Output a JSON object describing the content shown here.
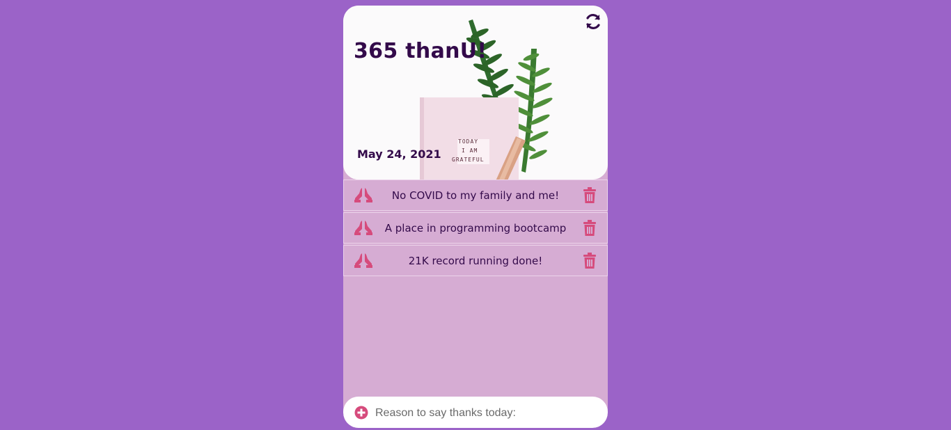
{
  "app": {
    "title": "365 thanU!",
    "date": "May 24, 2021"
  },
  "hero_image": {
    "notebook_text": [
      "TODAY",
      "I AM",
      "GRATEFUL"
    ]
  },
  "items": [
    {
      "text": "No COVID to my family and me!"
    },
    {
      "text": "A place in programming bootcamp"
    },
    {
      "text": "21K record running done!"
    }
  ],
  "composer": {
    "placeholder": "Reason to say thanks today:",
    "value": ""
  },
  "colors": {
    "background": "#9b63c8",
    "panel": "#d6acd3",
    "title_text": "#330a4a",
    "accent_icon": "#d64b7c"
  },
  "icons": {
    "refresh": "refresh-icon",
    "thanks": "praying-hands-icon",
    "delete": "trash-icon",
    "add": "plus-circle-icon"
  }
}
